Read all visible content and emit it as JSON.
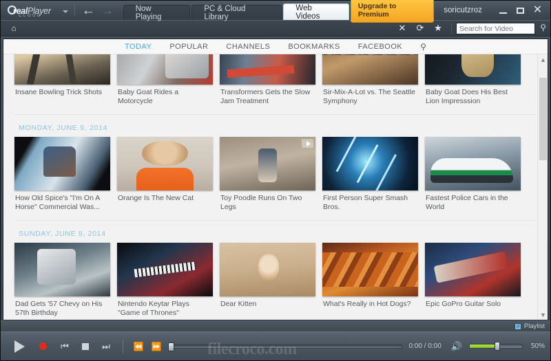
{
  "titlebar": {
    "logo": {
      "real": "real",
      "player": "Player",
      "cloud": "CLOUD"
    },
    "back_icon": "←",
    "forward_icon": "→",
    "tabs": [
      {
        "label": "Now Playing",
        "active": false
      },
      {
        "label": "PC & Cloud Library",
        "active": false
      },
      {
        "label": "Web Videos",
        "active": true
      }
    ],
    "upgrade_label": "Upgrade to Premium",
    "username": "soricutzroz",
    "minimize_icon": "minimize-icon",
    "maximize_icon": "maximize-icon",
    "close_icon": "✕"
  },
  "toolbar": {
    "home_icon": "⌂",
    "stop_icon": "✕",
    "refresh_icon": "⟳",
    "bookmark_icon": "★",
    "search_placeholder": "Search for Video",
    "search_value": "",
    "search_icon": "⚲"
  },
  "nav": {
    "tabs": [
      {
        "label": "TODAY",
        "active": true
      },
      {
        "label": "POPULAR",
        "active": false
      },
      {
        "label": "CHANNELS",
        "active": false
      },
      {
        "label": "BOOKMARKS",
        "active": false
      },
      {
        "label": "FACEBOOK",
        "active": false
      }
    ],
    "search_icon": "⚲"
  },
  "scroll": {
    "up_icon": "▲",
    "down_icon": "▼"
  },
  "groups": [
    {
      "date": "",
      "cards": [
        {
          "title": "Insane Bowling Trick Shots",
          "art": "t-bowling",
          "play_overlay": false
        },
        {
          "title": "Baby Goat Rides a Motorcycle",
          "art": "t-goat",
          "play_overlay": false
        },
        {
          "title": "Transformers Gets the Slow Jam Treatment",
          "art": "t-transformers",
          "play_overlay": false
        },
        {
          "title": "Sir-Mix-A-Lot vs. The Seattle Symphony",
          "art": "t-symphony",
          "play_overlay": false
        },
        {
          "title": "Baby Goat Does His Best Lion Impresssion",
          "art": "t-lion",
          "play_overlay": false
        }
      ]
    },
    {
      "date": "MONDAY, JUNE 9, 2014",
      "cards": [
        {
          "title": "How Old Spice's \"I'm On A Horse\" Commercial Was...",
          "art": "t-oldspice",
          "play_overlay": false
        },
        {
          "title": "Orange Is The New Cat",
          "art": "t-orangecat",
          "play_overlay": false
        },
        {
          "title": "Toy Poodle Runs On Two Legs",
          "art": "t-poodle",
          "play_overlay": true
        },
        {
          "title": "First Person Super Smash Bros.",
          "art": "t-smash",
          "play_overlay": false
        },
        {
          "title": "Fastest Police Cars in the World",
          "art": "t-police",
          "play_overlay": false
        }
      ]
    },
    {
      "date": "SUNDAY, JUNE 8, 2014",
      "cards": [
        {
          "title": "Dad Gets '57 Chevy on His 57th Birthday",
          "art": "t-chevy",
          "play_overlay": false
        },
        {
          "title": "Nintendo Keytar Plays \"Game of Thrones\"",
          "art": "t-keytar",
          "play_overlay": false
        },
        {
          "title": "Dear Kitten",
          "art": "t-kitten",
          "play_overlay": false
        },
        {
          "title": "What's Really in Hot Dogs?",
          "art": "t-hotdogs",
          "play_overlay": false
        },
        {
          "title": "Epic GoPro Guitar Solo",
          "art": "t-gopro",
          "play_overlay": false
        }
      ]
    }
  ],
  "playlist_strip": {
    "label": "Playlist",
    "icon": "♫"
  },
  "player": {
    "play_icon": "play-icon",
    "record_icon": "record-icon",
    "previous_icon": "⏮",
    "stop_icon": "stop-icon",
    "next_icon": "⏭",
    "rewind_icon": "⏪",
    "fastforward_icon": "⏩",
    "time": "0:00 / 0:00",
    "speaker_icon": "🔊",
    "volume_percent": "50%"
  },
  "watermark": "filecroco.com",
  "colors": {
    "accent_blue": "#4aa3e0",
    "date_blue": "#8ec2e8",
    "upgrade_orange": "#f5a623",
    "record_red": "#e02a1b",
    "volume_green": "#85c21e"
  }
}
